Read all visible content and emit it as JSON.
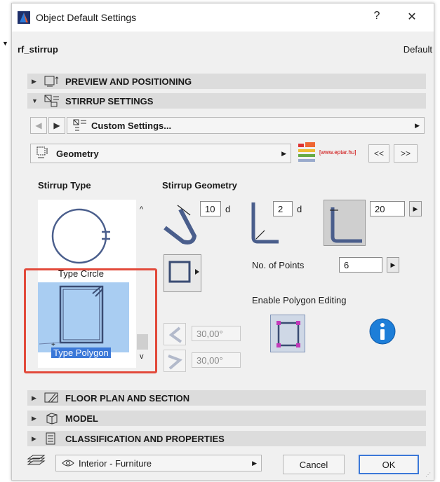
{
  "window": {
    "title": "Object Default Settings",
    "help_label": "?",
    "close_label": "✕"
  },
  "object": {
    "name": "rf_stirrup",
    "default_label": "Default"
  },
  "sections": {
    "preview": "PREVIEW AND POSITIONING",
    "stirrup": "STIRRUP SETTINGS",
    "floorplan": "FLOOR PLAN AND SECTION",
    "model": "MODEL",
    "classification": "CLASSIFICATION AND PROPERTIES"
  },
  "nav": {
    "custom_settings": "Custom Settings...",
    "geometry": "Geometry"
  },
  "logo": {
    "text": "[www.eptar.hu]"
  },
  "nav_buttons": {
    "prev": "<<",
    "next": ">>"
  },
  "stirrup_type": {
    "heading": "Stirrup Type",
    "items": [
      {
        "label": "Type Circle"
      },
      {
        "label": "Type Polygon",
        "selected": true
      }
    ]
  },
  "geometry": {
    "heading": "Stirrup Geometry",
    "bend_length": "10",
    "bend_unit": "d",
    "radius": "2",
    "radius_unit": "d",
    "hook": "20",
    "no_points_label": "No. of Points",
    "no_points": "6",
    "enable_polygon_label": "Enable Polygon Editing",
    "angle1": "30,00°",
    "angle2": "30,00°"
  },
  "footer": {
    "layer": "Interior - Furniture",
    "cancel": "Cancel",
    "ok": "OK"
  },
  "colors": {
    "accent": "#3b78d8",
    "highlight": "#e24a3b",
    "shape": "#4a5e8c"
  }
}
